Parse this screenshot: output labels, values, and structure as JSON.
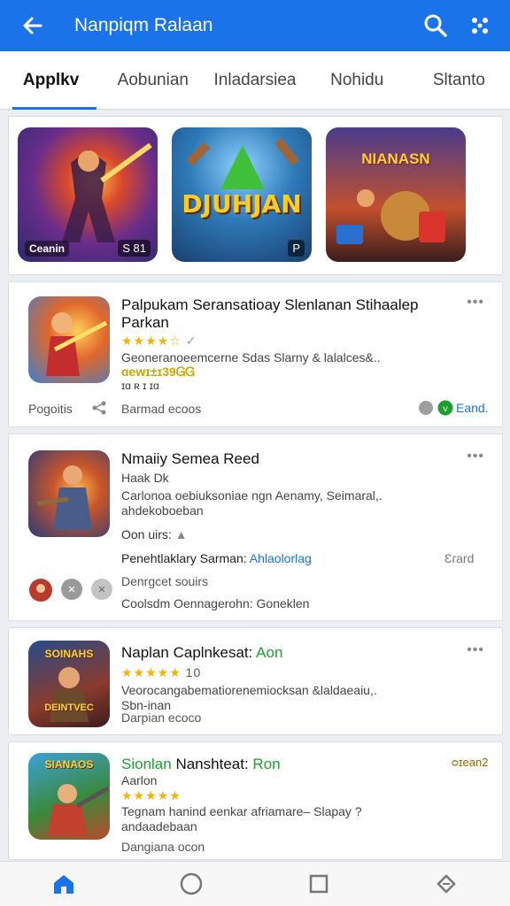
{
  "appbar": {
    "title": "Nanpiqm Ralaan",
    "back_icon": "arrow-left-icon",
    "search_icon": "search-icon",
    "menu_icon": "grid-dots-icon",
    "color": "#1a73e8"
  },
  "tabs": [
    {
      "label": "Applkv"
    },
    {
      "label": "Aobunian"
    },
    {
      "label": "Inladarsiea"
    },
    {
      "label": "Nohidu"
    },
    {
      "label": "Sltanto"
    }
  ],
  "featured": [
    {
      "left_label": "Ceanin",
      "right_label": "S 81"
    },
    {
      "big_text": "DJUHJAN",
      "right_label": "P"
    },
    {
      "banner": "NIANASN"
    }
  ],
  "apps": [
    {
      "title": "Palpukam Seransatioay Slenlanan Stihaalep Parkan",
      "stars": "★★★★☆",
      "rating_hint": "✓",
      "desc": "Geoneranoeemcerne Sdas Slarny & lalalces&..",
      "price": "ɑewɪ±ɪ39ᏀᏀ",
      "meta": "ɪɑ ʀ ɪ ɪɑ",
      "footer_left": "Pogoitis",
      "footer_mid": "Barmad ecoos",
      "footer_right": "Eand."
    },
    {
      "title": "Nmaiiy Semea Reed",
      "sub": "Haak Dk",
      "desc": "Carlonoa oebiuksoniae ngn Aenamy, Seimaral,. ahdekoboeban",
      "extra": "Oon uirs:",
      "label_line": "Penehtlaklary Sarman:",
      "label_link": "Ahlaolorlag",
      "right_badge": "Ɛɾard",
      "mid": "Denrgcet souirs",
      "bottom": "Coolsdm Oennagerohn: Goneklen"
    },
    {
      "title_prefix": "Naplan Caplnkesat:",
      "title_green": "Aon",
      "stars": "★★★★★",
      "rating_num": "10",
      "desc": "Veorocangabematiorenemiocksan &laldaeaiu,. Sbn-inan",
      "footer": "Darpian ecoco",
      "icon_tag": "SOINAHS",
      "icon_tag2": "DEINTVEC"
    },
    {
      "title_prefix": "Sionlan",
      "title_mid": "Nanshteat:",
      "title_green": "Ron",
      "sub": "Aarlon",
      "stars": "★★★★★",
      "right_badge": "ᴑɪean2",
      "desc": "Tegnam hanind eenkar afriamare– Slapay ? andaadebaan",
      "footer": "Dangiana ocon",
      "icon_tag": "SIANAOS"
    }
  ],
  "navbar": {
    "home_icon": "home-icon",
    "circle_icon": "circle-icon",
    "square_icon": "square-icon",
    "diamond_icon": "diamond-icon",
    "active_color": "#1a73e8"
  }
}
